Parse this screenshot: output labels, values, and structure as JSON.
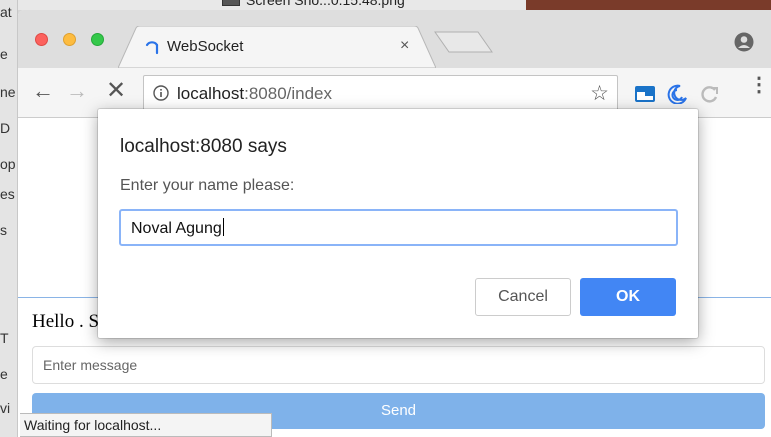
{
  "background": {
    "left_strip_letters": [
      "at",
      "e",
      "ne",
      "D",
      "op",
      "es",
      "s",
      "T",
      "e",
      "vi"
    ],
    "finder_filename": "Screen Sho...0.15.48.png"
  },
  "browser": {
    "tab": {
      "title": "WebSocket",
      "close": "×"
    },
    "toolbar": {
      "back": "←",
      "forward": "→",
      "stop": "✕",
      "url_host": "localhost",
      "url_rest": ":8080/index",
      "star": "☆",
      "menu": "⋮"
    }
  },
  "page": {
    "greeting": "Hello . S",
    "message_placeholder": "Enter message",
    "send_label": "Send"
  },
  "status_bar": {
    "text": "Waiting for localhost..."
  },
  "dialog": {
    "title": "localhost:8080 says",
    "message": "Enter your name please:",
    "input_value": "Noval Agung",
    "cancel_label": "Cancel",
    "ok_label": "OK"
  },
  "colors": {
    "accent": "#4286f4",
    "send_button": "#7fb2ea",
    "focus_ring": "#8ab4f8"
  }
}
